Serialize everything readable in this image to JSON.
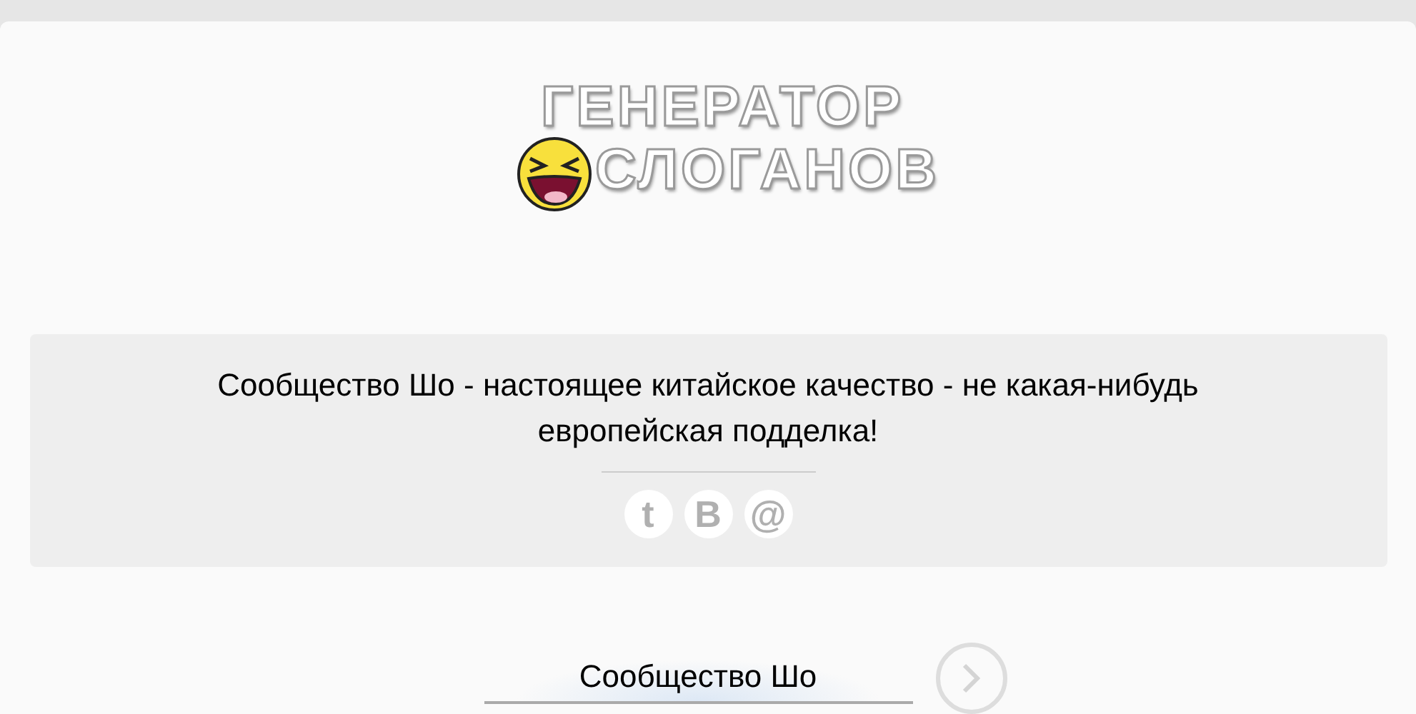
{
  "logo": {
    "lines": [
      "ГЕНЕРАТОР",
      "СЛОГАНОВ"
    ]
  },
  "slogan": {
    "text": "Сообщество Шо - настоящее китайское качество - не какая-нибудь европейская подделка!",
    "share_icons": [
      {
        "glyph": "t"
      },
      {
        "glyph": "B"
      },
      {
        "glyph": "@"
      }
    ]
  },
  "input": {
    "value": "Сообщество Шо"
  }
}
